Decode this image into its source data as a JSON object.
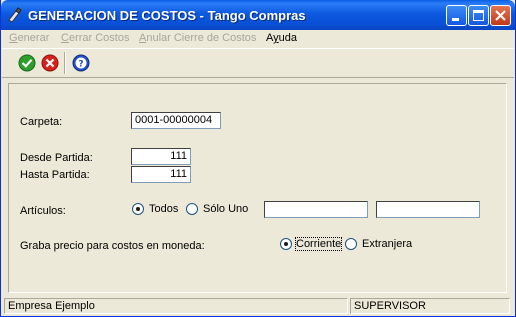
{
  "window": {
    "title": "GENERACION DE COSTOS - Tango Compras"
  },
  "menu": {
    "generar": "Generar",
    "cerrar_costos": "Cerrar Costos",
    "anular": "Anular Cierre de Costos",
    "ayuda": "Ayuda"
  },
  "toolbar": {
    "icons": [
      "accept-icon",
      "cancel-icon",
      "help-icon"
    ],
    "colors": {
      "accept": "#2c9e2c",
      "cancel": "#d8221b",
      "help": "#2450c8"
    }
  },
  "form": {
    "carpeta_label": "Carpeta:",
    "carpeta_value": "0001-00000004",
    "desde_label": "Desde Partida:",
    "desde_value": "111",
    "hasta_label": "Hasta Partida:",
    "hasta_value": "111",
    "articulos_label": "Artículos:",
    "todos_label": "Todos",
    "solo_uno_label": "Sólo Uno",
    "articulo_desde_value": "",
    "articulo_hasta_value": "",
    "articulos_selected": "Todos",
    "moneda_label": "Graba precio para costos en moneda:",
    "corriente_label": "Corriente",
    "extranjera_label": "Extranjera",
    "moneda_selected": "Corriente"
  },
  "status": {
    "empresa": "Empresa Ejemplo",
    "usuario": "SUPERVISOR"
  },
  "colors": {
    "titlebar": "#0a5fe6",
    "face": "#ece9d8",
    "disabled_text": "#a7a69c"
  }
}
